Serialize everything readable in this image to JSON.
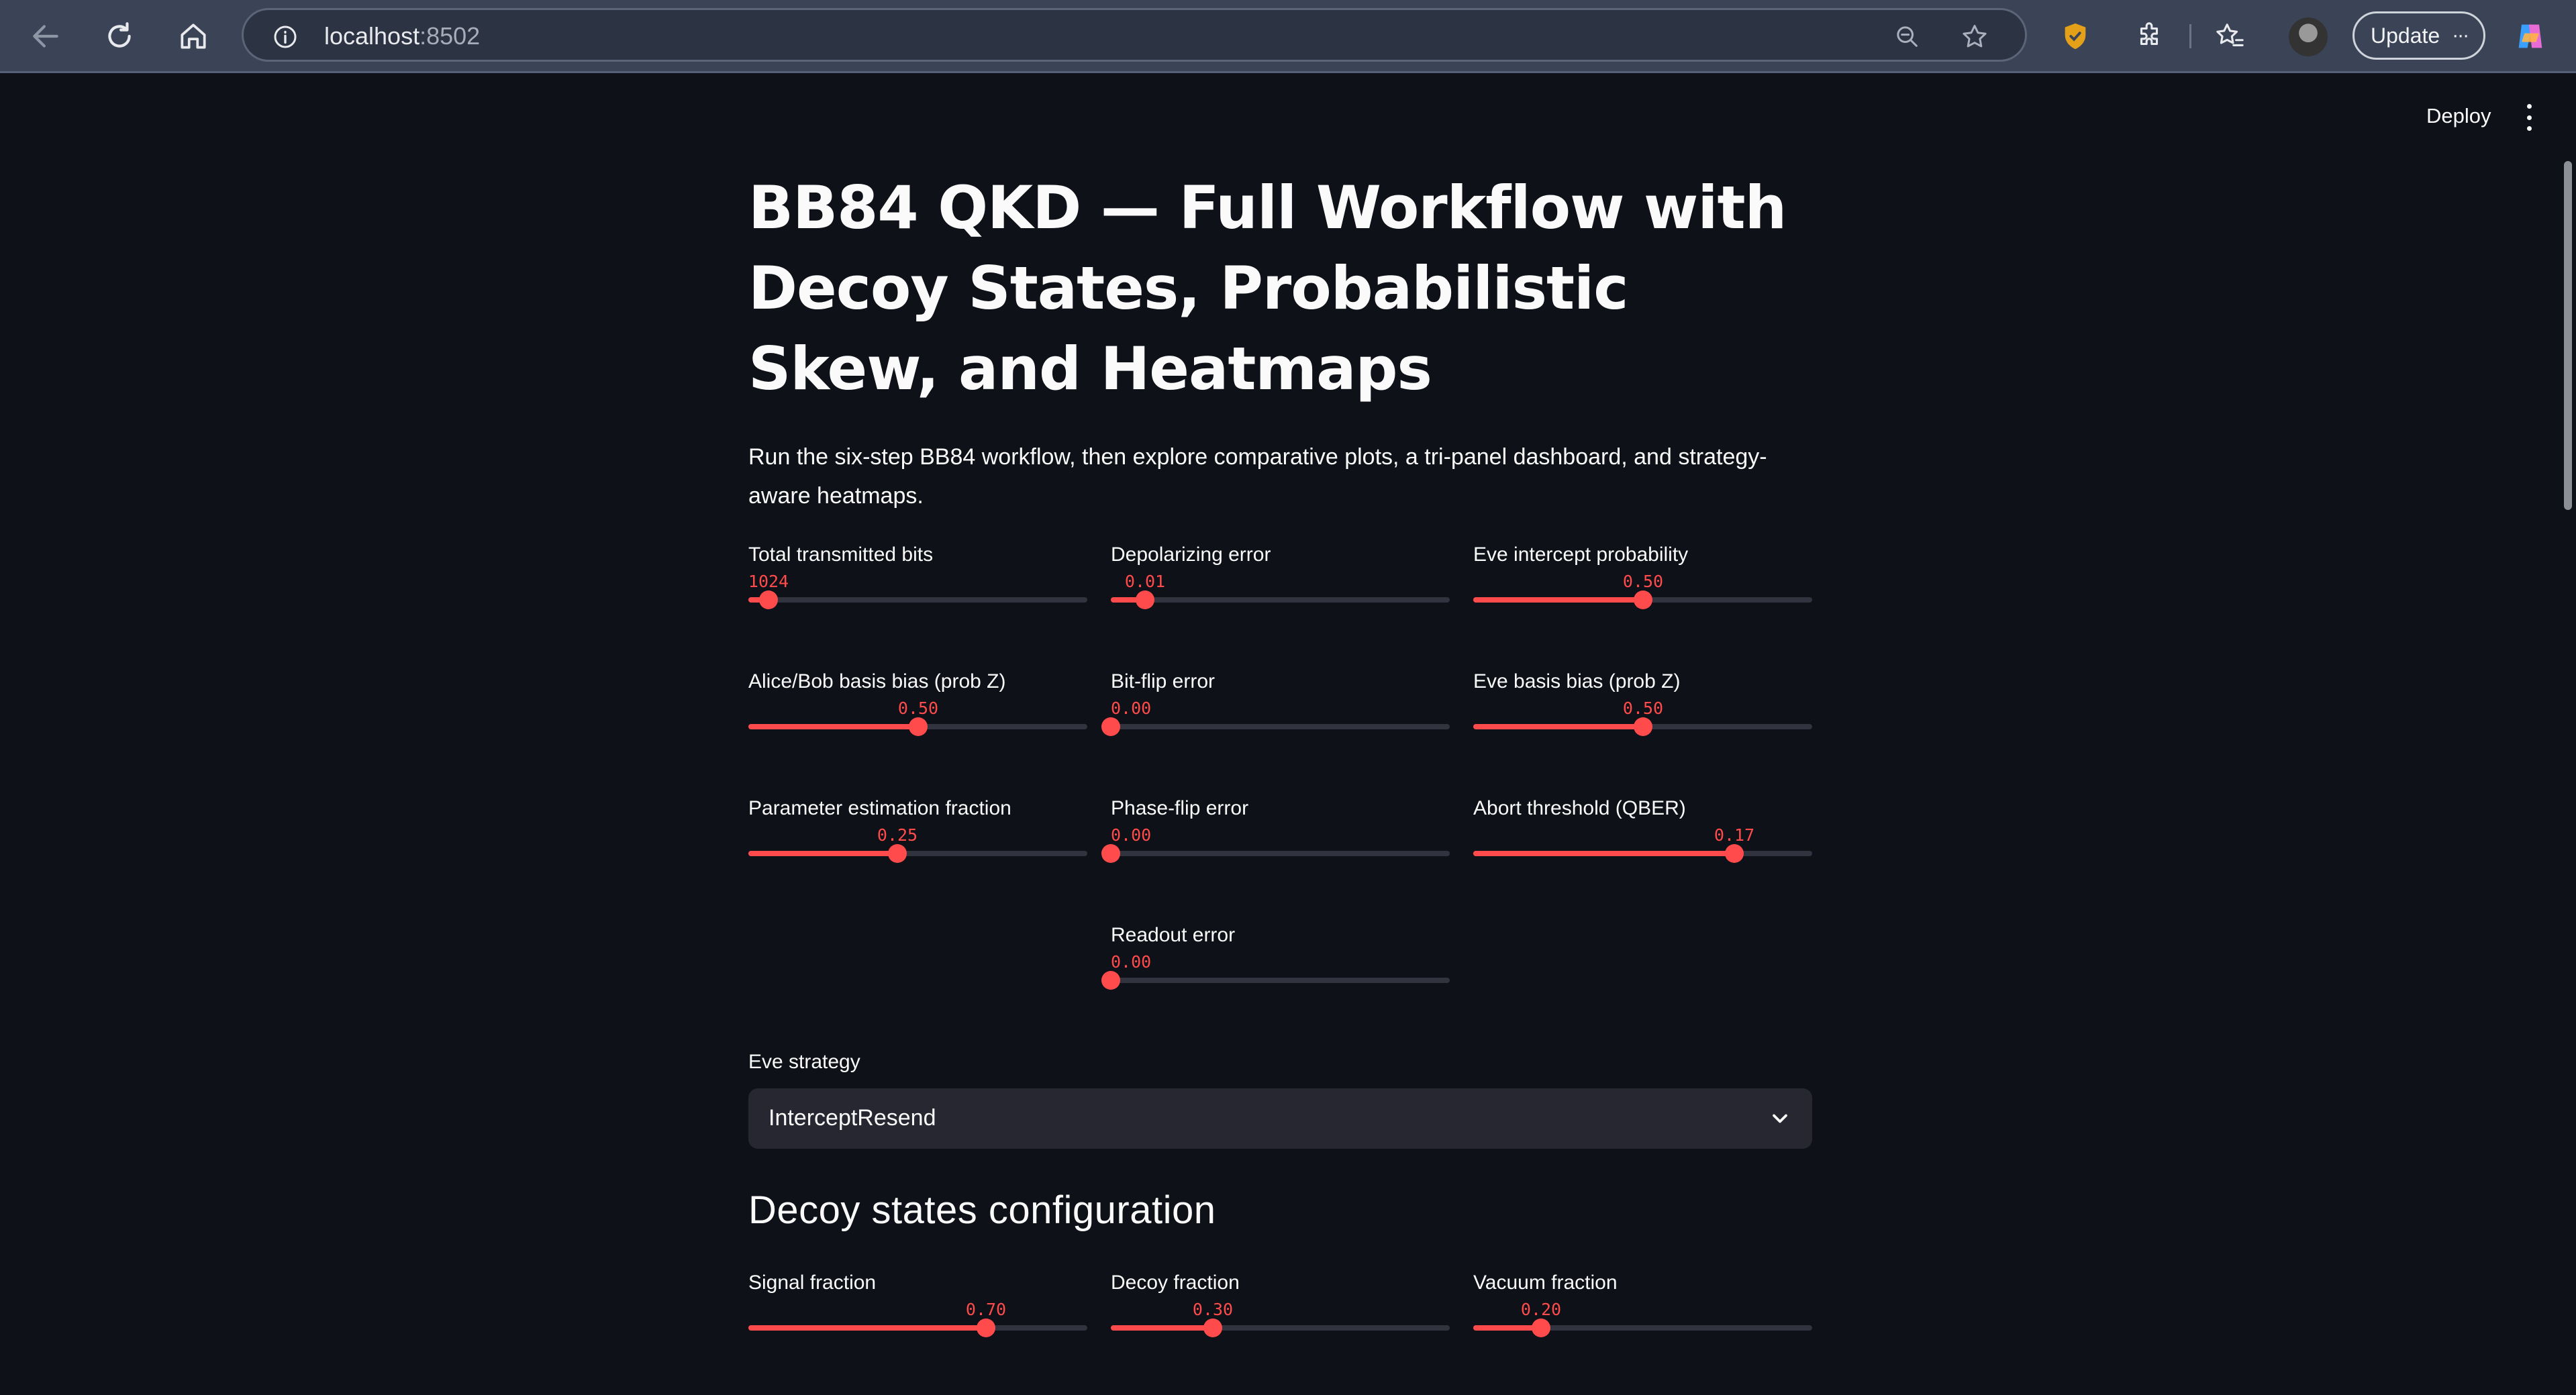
{
  "browser": {
    "url_host": "localhost",
    "url_port": ":8502",
    "update_label": "Update",
    "update_more": "···"
  },
  "header": {
    "deploy_label": "Deploy"
  },
  "main": {
    "title": "BB84 QKD — Full Workflow with Decoy States, Probabilistic Skew, and Heatmaps",
    "subtitle": "Run the six-step BB84 workflow, then explore comparative plots, a tri-panel dashboard, and strategy-aware heatmaps."
  },
  "sliders": [
    {
      "label": "Total transmitted bits",
      "value": "1024",
      "fraction": 0.06
    },
    {
      "label": "Depolarizing error",
      "value": "0.01",
      "fraction": 0.1
    },
    {
      "label": "Eve intercept probability",
      "value": "0.50",
      "fraction": 0.5
    },
    {
      "label": "Alice/Bob basis bias (prob Z)",
      "value": "0.50",
      "fraction": 0.5
    },
    {
      "label": "Bit-flip error",
      "value": "0.00",
      "fraction": 0.0
    },
    {
      "label": "Eve basis bias (prob Z)",
      "value": "0.50",
      "fraction": 0.5
    },
    {
      "label": "Parameter estimation fraction",
      "value": "0.25",
      "fraction": 0.44
    },
    {
      "label": "Phase-flip error",
      "value": "0.00",
      "fraction": 0.0
    },
    {
      "label": "Abort threshold (QBER)",
      "value": "0.17",
      "fraction": 0.77
    },
    {
      "label": "Readout error",
      "value": "0.00",
      "fraction": 0.0
    }
  ],
  "eve_strategy": {
    "label": "Eve strategy",
    "selected": "InterceptResend"
  },
  "decoy": {
    "heading": "Decoy states configuration",
    "sliders": [
      {
        "label": "Signal fraction",
        "value": "0.70",
        "fraction": 0.7
      },
      {
        "label": "Decoy fraction",
        "value": "0.30",
        "fraction": 0.3
      },
      {
        "label": "Vacuum fraction",
        "value": "0.20",
        "fraction": 0.2
      }
    ]
  },
  "colors": {
    "accent": "#ff4b4b",
    "background": "#0e1117",
    "track": "#31333f",
    "select_bg": "#262730"
  }
}
